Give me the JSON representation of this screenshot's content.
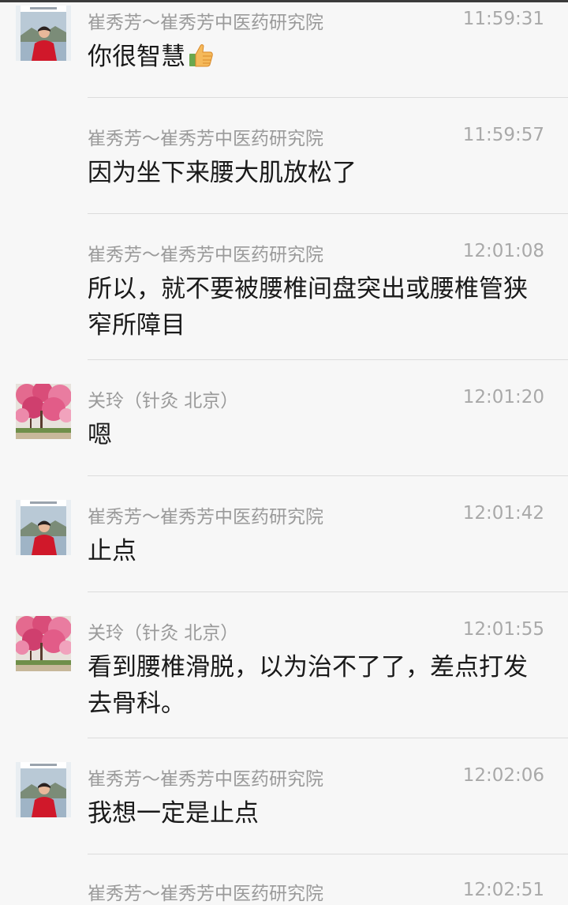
{
  "messages": [
    {
      "sender": "崔秀芳～崔秀芳中医药研究院",
      "time": "11:59:31",
      "text": "你很智慧",
      "avatar": "avatar-cui",
      "show_avatar": true,
      "emoji": "thumbs-up-icon"
    },
    {
      "sender": "崔秀芳～崔秀芳中医药研究院",
      "time": "11:59:57",
      "text": "因为坐下来腰大肌放松了",
      "avatar": "avatar-cui",
      "show_avatar": false
    },
    {
      "sender": "崔秀芳～崔秀芳中医药研究院",
      "time": "12:01:08",
      "text": "所以，就不要被腰椎间盘突出或腰椎管狭窄所障目",
      "avatar": "avatar-cui",
      "show_avatar": false
    },
    {
      "sender": "关玲（针灸 北京）",
      "time": "12:01:20",
      "text": "嗯",
      "avatar": "avatar-guan",
      "show_avatar": true
    },
    {
      "sender": "崔秀芳～崔秀芳中医药研究院",
      "time": "12:01:42",
      "text": "止点",
      "avatar": "avatar-cui",
      "show_avatar": true
    },
    {
      "sender": "关玲（针灸 北京）",
      "time": "12:01:55",
      "text": "看到腰椎滑脱，以为治不了了，差点打发去骨科。",
      "avatar": "avatar-guan",
      "show_avatar": true
    },
    {
      "sender": "崔秀芳～崔秀芳中医药研究院",
      "time": "12:02:06",
      "text": "我想一定是止点",
      "avatar": "avatar-cui",
      "show_avatar": true
    },
    {
      "sender": "崔秀芳～崔秀芳中医药研究院",
      "time": "12:02:51",
      "text": "",
      "avatar": "avatar-cui",
      "show_avatar": false
    }
  ],
  "colors": {
    "background": "#f7f7f7",
    "sender": "#9a9a9a",
    "time": "#a9a9a9",
    "text": "#1a1a1a",
    "divider": "#dcdcdc"
  }
}
